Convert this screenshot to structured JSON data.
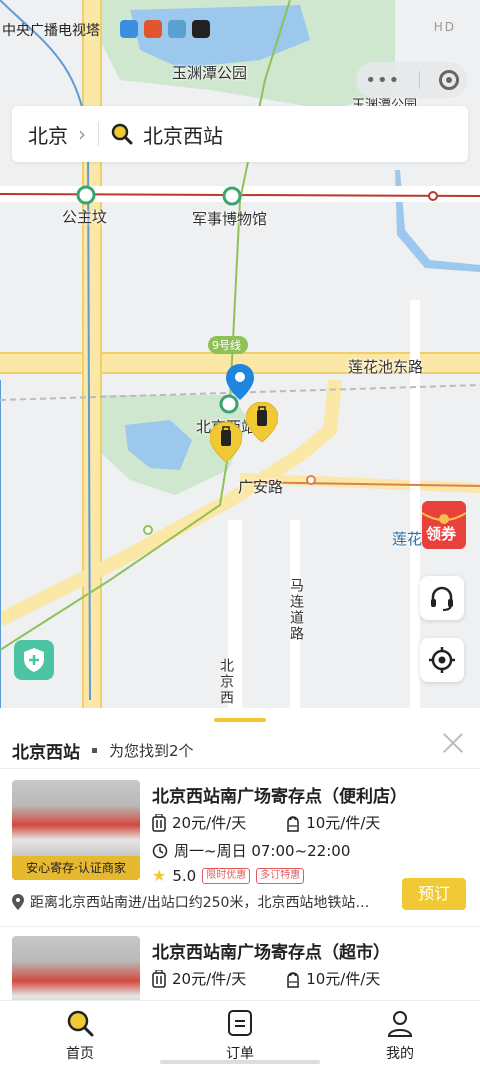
{
  "status_bar": {
    "left_text": "中央广播电视塔",
    "right_text": "HD"
  },
  "map": {
    "labels": {
      "park": "玉渊潭公园",
      "park2": "玉渊潭公园",
      "gongzhufen": "公主坟",
      "museum": "军事博物馆",
      "line9": "9号线",
      "lianhuachi": "莲花池东路",
      "beijingwest": "北京西站",
      "guangan": "广安路",
      "malian": "马连道路",
      "beijingxi_road": "北京西",
      "lianhua": "莲花"
    },
    "promo_text": "领券"
  },
  "search": {
    "city": "北京",
    "query": "北京西站"
  },
  "sheet": {
    "title": "北京西站",
    "result_count": "为您找到2个",
    "stores": [
      {
        "name": "北京西站南广场寄存点（便利店）",
        "badge": "安心寄存·认证商家",
        "price_large": "20元/件/天",
        "price_small": "10元/件/天",
        "hours": "周一~周日 07:00~22:00",
        "rating": "5.0",
        "tags": [
          "限时优惠",
          "多订特惠"
        ],
        "address": "距离北京西站南进/出站口约250米，北京西站地铁站…",
        "book_label": "预订"
      },
      {
        "name": "北京西站南广场寄存点（超市）",
        "price_large": "20元/件/天",
        "price_small": "10元/件/天"
      }
    ]
  },
  "tabs": [
    {
      "label": "首页",
      "icon": "search-icon"
    },
    {
      "label": "订单",
      "icon": "order-icon"
    },
    {
      "label": "我的",
      "icon": "profile-icon"
    }
  ],
  "colors": {
    "accent": "#f1c935",
    "tag_red": "#e35b5b",
    "shield_green": "#4cc3a2",
    "pin_blue": "#1f86e0"
  }
}
